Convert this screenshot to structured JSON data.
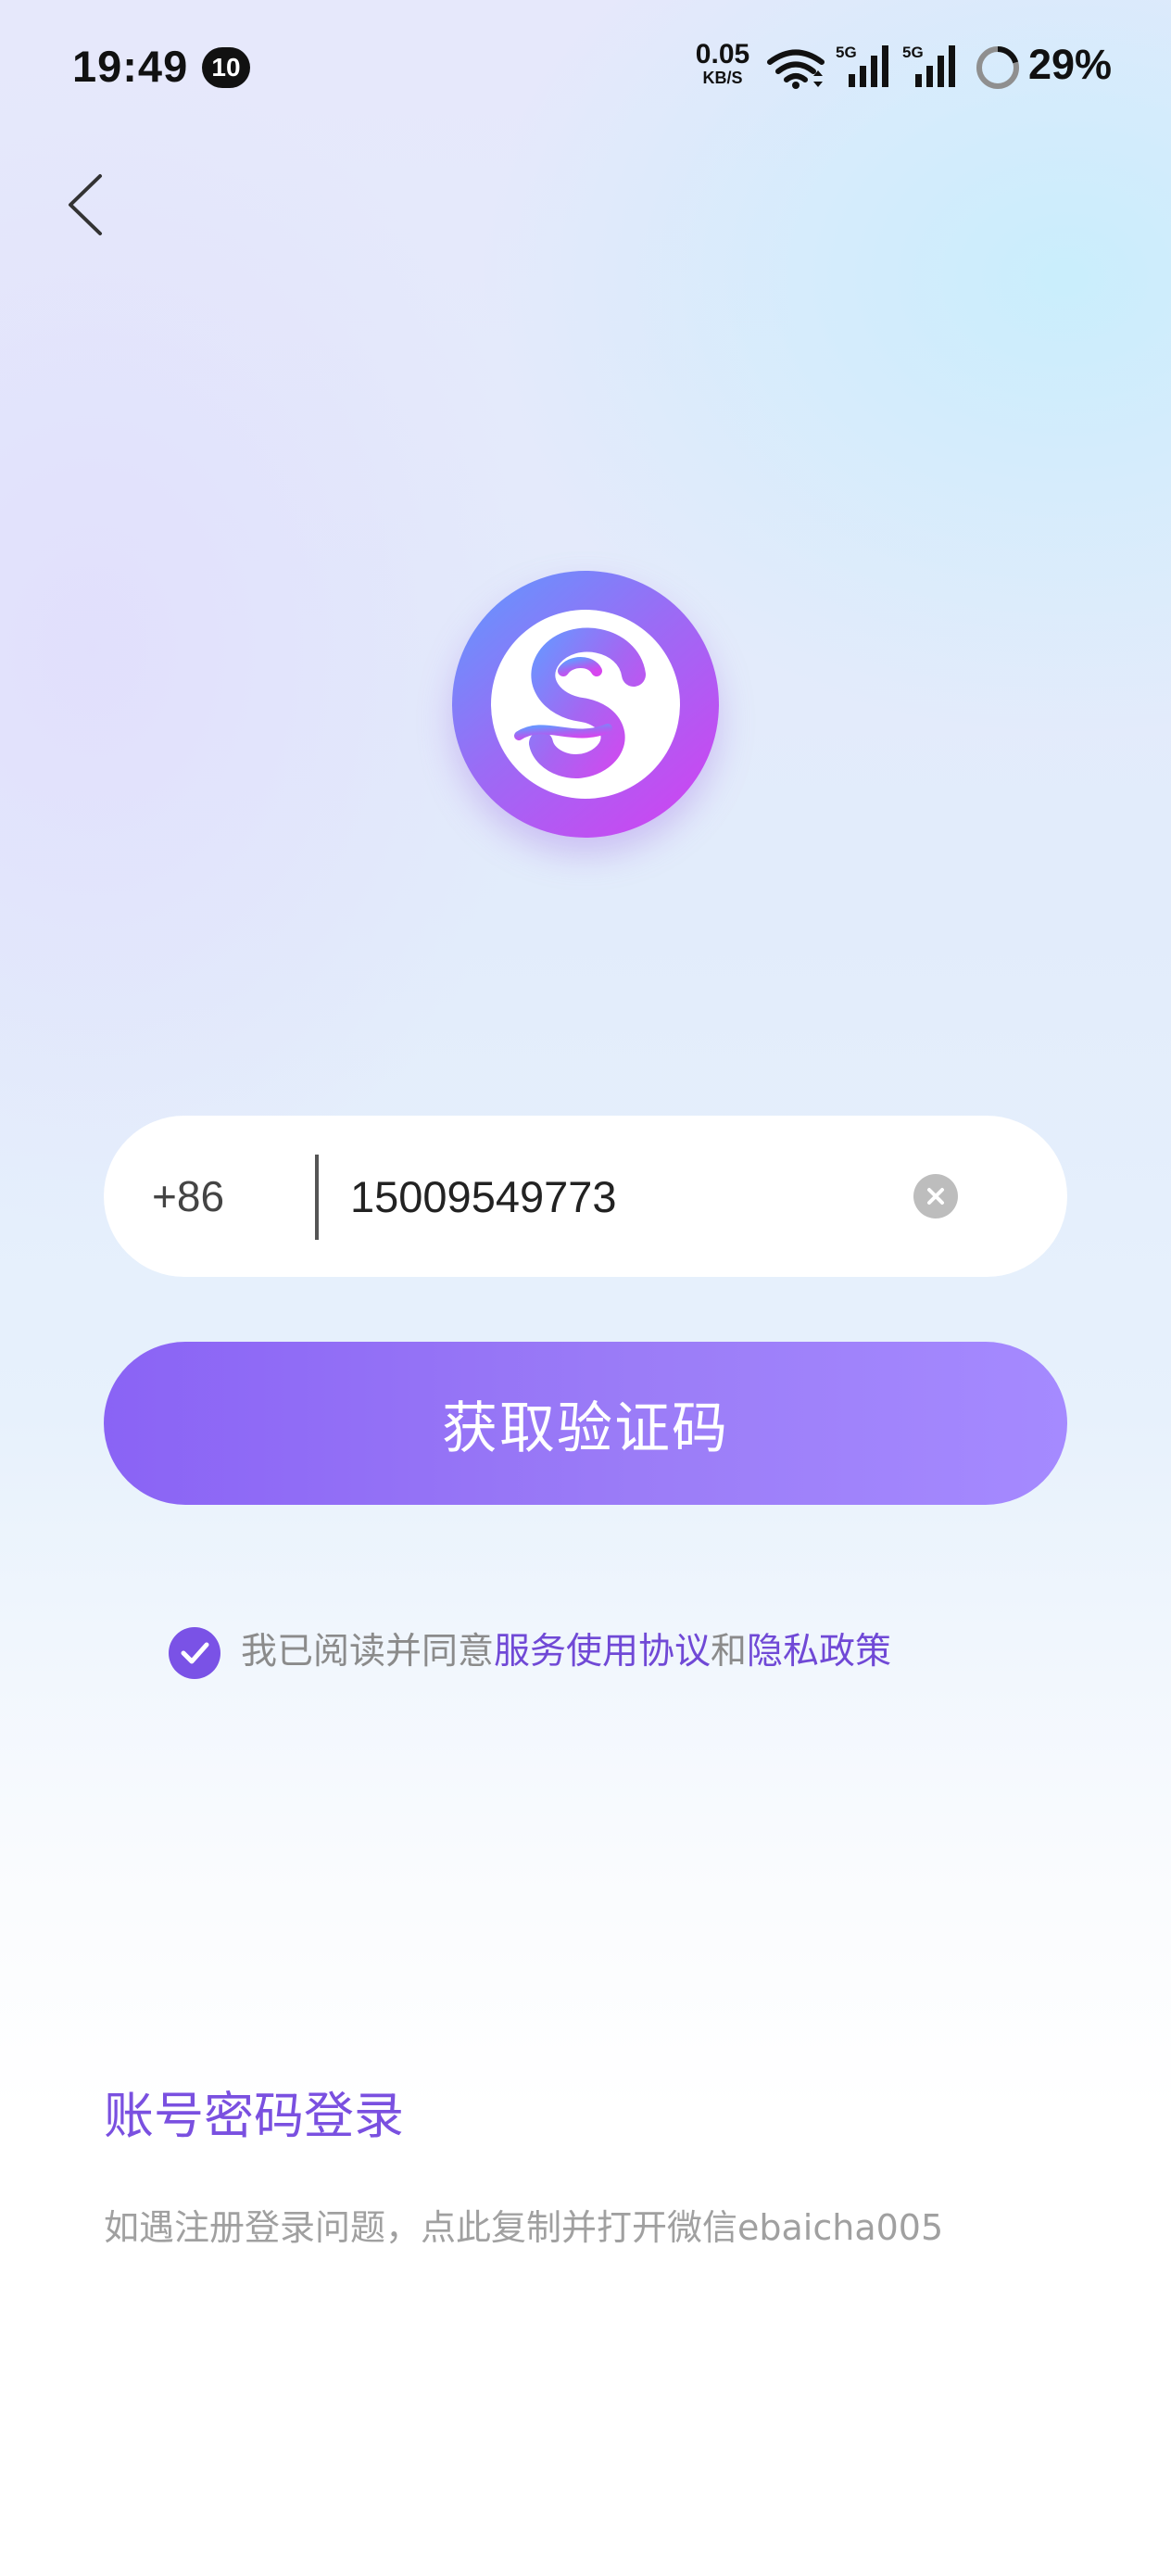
{
  "status_bar": {
    "time": "19:49",
    "notification_count": "10",
    "net_speed_value": "0.05",
    "net_speed_unit": "KB/S",
    "signal_1_label": "5G",
    "signal_2_label": "5G",
    "battery_percent": "29%",
    "icons": [
      "wifi-icon",
      "signal-5g-icon",
      "signal-5g-icon",
      "battery-ring-icon"
    ]
  },
  "nav": {
    "back_icon": "chevron-left-icon"
  },
  "logo": {
    "icon": "swirl-s-logo",
    "colors": [
      "#5d9bff",
      "#9a6cf5",
      "#d53ff0"
    ]
  },
  "login_form": {
    "country_code": "+86",
    "phone_value": "15009549773",
    "clear_icon": "close-circle-icon",
    "get_code_label": "获取验证码"
  },
  "agreement": {
    "checked": true,
    "prefix": "我已阅读并同意",
    "terms_link": "服务使用协议",
    "conjunction": "和",
    "privacy_link": "隐私政策"
  },
  "footer": {
    "password_login_label": "账号密码登录",
    "help_text": "如遇注册登录问题，点此复制并打开微信ebaicha005"
  },
  "colors": {
    "accent": "#7a52e6",
    "link": "#7049d6",
    "button_gradient": [
      "#8a63f5",
      "#a58aff"
    ]
  }
}
